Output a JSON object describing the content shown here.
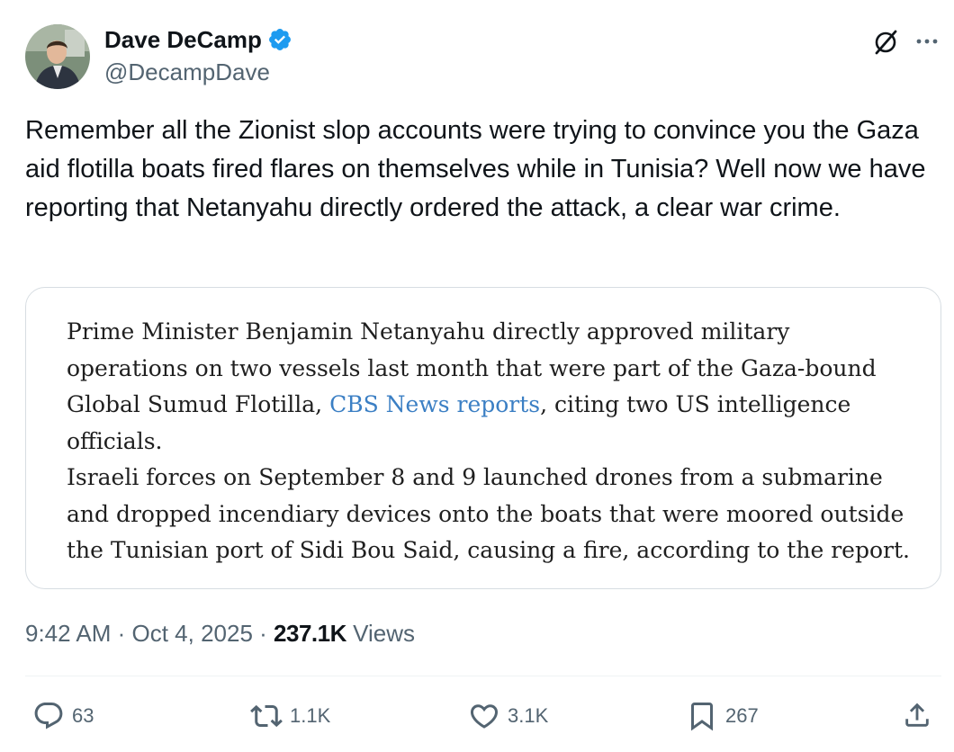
{
  "author": {
    "display_name": "Dave DeCamp",
    "handle": "@DecampDave",
    "verified": true
  },
  "header_icons": [
    "grok-icon",
    "more-options-icon"
  ],
  "tweet": {
    "text": "Remember all the Zionist slop accounts were trying to convince you the Gaza aid flotilla boats fired flares on themselves while in Tunisia? Well now we have reporting that Netanyahu directly ordered the attack, a clear war crime."
  },
  "quote": {
    "p1_before": "Prime Minister Benjamin Netanyahu directly approved military operations on two vessels last month that were part of the Gaza-bound Global Sumud Flotilla, ",
    "p1_link": "CBS News reports",
    "p1_after": ", citing two US intelligence officials.",
    "p2": "Israeli forces on September 8 and 9 launched drones from a submarine and dropped incendiary devices onto the boats that were moored outside the Tunisian port of Sidi Bou Said, causing a fire, according to the report."
  },
  "meta": {
    "time": "9:42 AM",
    "sep1": " · ",
    "date": "Oct 4, 2025",
    "sep2": " · ",
    "views_count": "237.1K",
    "views_label": " Views"
  },
  "actions": {
    "replies": "63",
    "reposts": "1.1K",
    "likes": "3.1K",
    "bookmarks": "267"
  },
  "colors": {
    "text": "#0f1419",
    "secondary": "#536471",
    "verified_blue": "#1d9bf0",
    "link": "#3b7fc4",
    "border": "#d7dde2"
  }
}
